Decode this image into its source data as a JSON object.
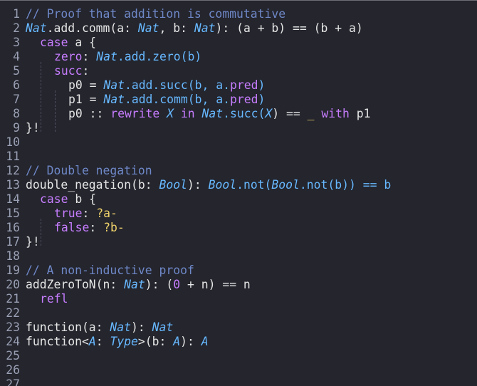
{
  "editor": {
    "colors": {
      "background": "#24252d",
      "line_number": "#9aa0b4",
      "comment": "#6f88c8",
      "type": "#67b8ff",
      "keyword": "#c77dff",
      "hole": "#f0d36b",
      "text": "#e6e6e6"
    },
    "lines": [
      {
        "n": "1",
        "indent": 0,
        "guides": 0,
        "tokens": [
          {
            "t": "// Proof that addition is commutative",
            "c": "comment"
          }
        ]
      },
      {
        "n": "2",
        "indent": 0,
        "guides": 0,
        "tokens": [
          {
            "t": "Nat",
            "c": "type"
          },
          {
            "t": ".add.comm(",
            "c": "plain"
          },
          {
            "t": "a",
            "c": "plain"
          },
          {
            "t": ": ",
            "c": "plain"
          },
          {
            "t": "Nat",
            "c": "type"
          },
          {
            "t": ", b: ",
            "c": "plain"
          },
          {
            "t": "Nat",
            "c": "type"
          },
          {
            "t": "): (a + b) == (b + a)",
            "c": "plain"
          }
        ]
      },
      {
        "n": "3",
        "indent": 1,
        "guides": 0,
        "tokens": [
          {
            "t": "case",
            "c": "kw"
          },
          {
            "t": " a {",
            "c": "plain"
          }
        ]
      },
      {
        "n": "4",
        "indent": 1,
        "guides": 1,
        "tokens": [
          {
            "t": "zero",
            "c": "kw"
          },
          {
            "t": ": ",
            "c": "plain"
          },
          {
            "t": "Nat",
            "c": "type"
          },
          {
            "t": ".add.zero(b)",
            "c": "fn"
          }
        ]
      },
      {
        "n": "5",
        "indent": 1,
        "guides": 1,
        "tokens": [
          {
            "t": "succ",
            "c": "kw"
          },
          {
            "t": ":",
            "c": "plain"
          }
        ]
      },
      {
        "n": "6",
        "indent": 1,
        "guides": 2,
        "tokens": [
          {
            "t": "p0 = ",
            "c": "plain"
          },
          {
            "t": "Nat",
            "c": "type"
          },
          {
            "t": ".add.succ(b, a.",
            "c": "fn"
          },
          {
            "t": "pred",
            "c": "kw"
          },
          {
            "t": ")",
            "c": "fn"
          }
        ]
      },
      {
        "n": "7",
        "indent": 1,
        "guides": 2,
        "tokens": [
          {
            "t": "p1 = ",
            "c": "plain"
          },
          {
            "t": "Nat",
            "c": "type"
          },
          {
            "t": ".add.comm(b, a.",
            "c": "fn"
          },
          {
            "t": "pred",
            "c": "kw"
          },
          {
            "t": ")",
            "c": "fn"
          }
        ]
      },
      {
        "n": "8",
        "indent": 1,
        "guides": 2,
        "tokens": [
          {
            "t": "p0 :: ",
            "c": "plain"
          },
          {
            "t": "rewrite",
            "c": "kw"
          },
          {
            "t": " ",
            "c": "plain"
          },
          {
            "t": "X",
            "c": "type"
          },
          {
            "t": " ",
            "c": "plain"
          },
          {
            "t": "in",
            "c": "kw"
          },
          {
            "t": " ",
            "c": "plain"
          },
          {
            "t": "Nat",
            "c": "type"
          },
          {
            "t": ".succ(",
            "c": "fn"
          },
          {
            "t": "X",
            "c": "type"
          },
          {
            "t": ") == ",
            "c": "plain"
          },
          {
            "t": "_",
            "c": "hole"
          },
          {
            "t": " ",
            "c": "plain"
          },
          {
            "t": "with",
            "c": "kw"
          },
          {
            "t": " p1",
            "c": "plain"
          }
        ]
      },
      {
        "n": "9",
        "indent": 0,
        "guides": 0,
        "tokens": [
          {
            "t": "}!",
            "c": "plain"
          }
        ]
      },
      {
        "n": "10",
        "indent": 0,
        "guides": 0,
        "tokens": []
      },
      {
        "n": "11",
        "indent": 0,
        "guides": 0,
        "tokens": []
      },
      {
        "n": "12",
        "indent": 0,
        "guides": 0,
        "tokens": [
          {
            "t": "// Double negation",
            "c": "comment"
          }
        ]
      },
      {
        "n": "13",
        "indent": 0,
        "guides": 0,
        "tokens": [
          {
            "t": "double_negation(b: ",
            "c": "plain"
          },
          {
            "t": "Bool",
            "c": "type"
          },
          {
            "t": "): ",
            "c": "plain"
          },
          {
            "t": "Bool",
            "c": "type"
          },
          {
            "t": ".not(",
            "c": "fn"
          },
          {
            "t": "Bool",
            "c": "type"
          },
          {
            "t": ".not(b)) == b",
            "c": "fn"
          }
        ]
      },
      {
        "n": "14",
        "indent": 1,
        "guides": 0,
        "tokens": [
          {
            "t": "case",
            "c": "kw"
          },
          {
            "t": " b {",
            "c": "plain"
          }
        ]
      },
      {
        "n": "15",
        "indent": 1,
        "guides": 1,
        "tokens": [
          {
            "t": "true",
            "c": "kw"
          },
          {
            "t": ": ",
            "c": "plain"
          },
          {
            "t": "?a-",
            "c": "hole"
          }
        ]
      },
      {
        "n": "16",
        "indent": 1,
        "guides": 1,
        "tokens": [
          {
            "t": "false",
            "c": "kw"
          },
          {
            "t": ": ",
            "c": "plain"
          },
          {
            "t": "?b-",
            "c": "hole"
          }
        ]
      },
      {
        "n": "17",
        "indent": 0,
        "guides": 0,
        "tokens": [
          {
            "t": "}!",
            "c": "plain"
          }
        ]
      },
      {
        "n": "18",
        "indent": 0,
        "guides": 0,
        "tokens": []
      },
      {
        "n": "19",
        "indent": 0,
        "guides": 0,
        "tokens": [
          {
            "t": "// A non-inductive proof",
            "c": "comment"
          }
        ]
      },
      {
        "n": "20",
        "indent": 0,
        "guides": 0,
        "tokens": [
          {
            "t": "addZeroToN(n: ",
            "c": "plain"
          },
          {
            "t": "Nat",
            "c": "type"
          },
          {
            "t": "): (",
            "c": "plain"
          },
          {
            "t": "0",
            "c": "num"
          },
          {
            "t": " + n) == n",
            "c": "plain"
          }
        ]
      },
      {
        "n": "21",
        "indent": 1,
        "guides": 0,
        "tokens": [
          {
            "t": "refl",
            "c": "kw"
          }
        ]
      },
      {
        "n": "22",
        "indent": 0,
        "guides": 0,
        "tokens": []
      },
      {
        "n": "23",
        "indent": 0,
        "guides": 0,
        "tokens": [
          {
            "t": "function(a: ",
            "c": "plain"
          },
          {
            "t": "Nat",
            "c": "type"
          },
          {
            "t": "): ",
            "c": "plain"
          },
          {
            "t": "Nat",
            "c": "type"
          }
        ]
      },
      {
        "n": "24",
        "indent": 0,
        "guides": 0,
        "tokens": [
          {
            "t": "function<",
            "c": "plain"
          },
          {
            "t": "A",
            "c": "type"
          },
          {
            "t": ": ",
            "c": "plain"
          },
          {
            "t": "Type",
            "c": "type"
          },
          {
            "t": ">(b: ",
            "c": "plain"
          },
          {
            "t": "A",
            "c": "type"
          },
          {
            "t": "): ",
            "c": "plain"
          },
          {
            "t": "A",
            "c": "type"
          }
        ]
      },
      {
        "n": "25",
        "indent": 0,
        "guides": 0,
        "tokens": []
      },
      {
        "n": "26",
        "indent": 0,
        "guides": 0,
        "tokens": []
      },
      {
        "n": "27",
        "indent": 0,
        "guides": 0,
        "tokens": []
      }
    ]
  }
}
